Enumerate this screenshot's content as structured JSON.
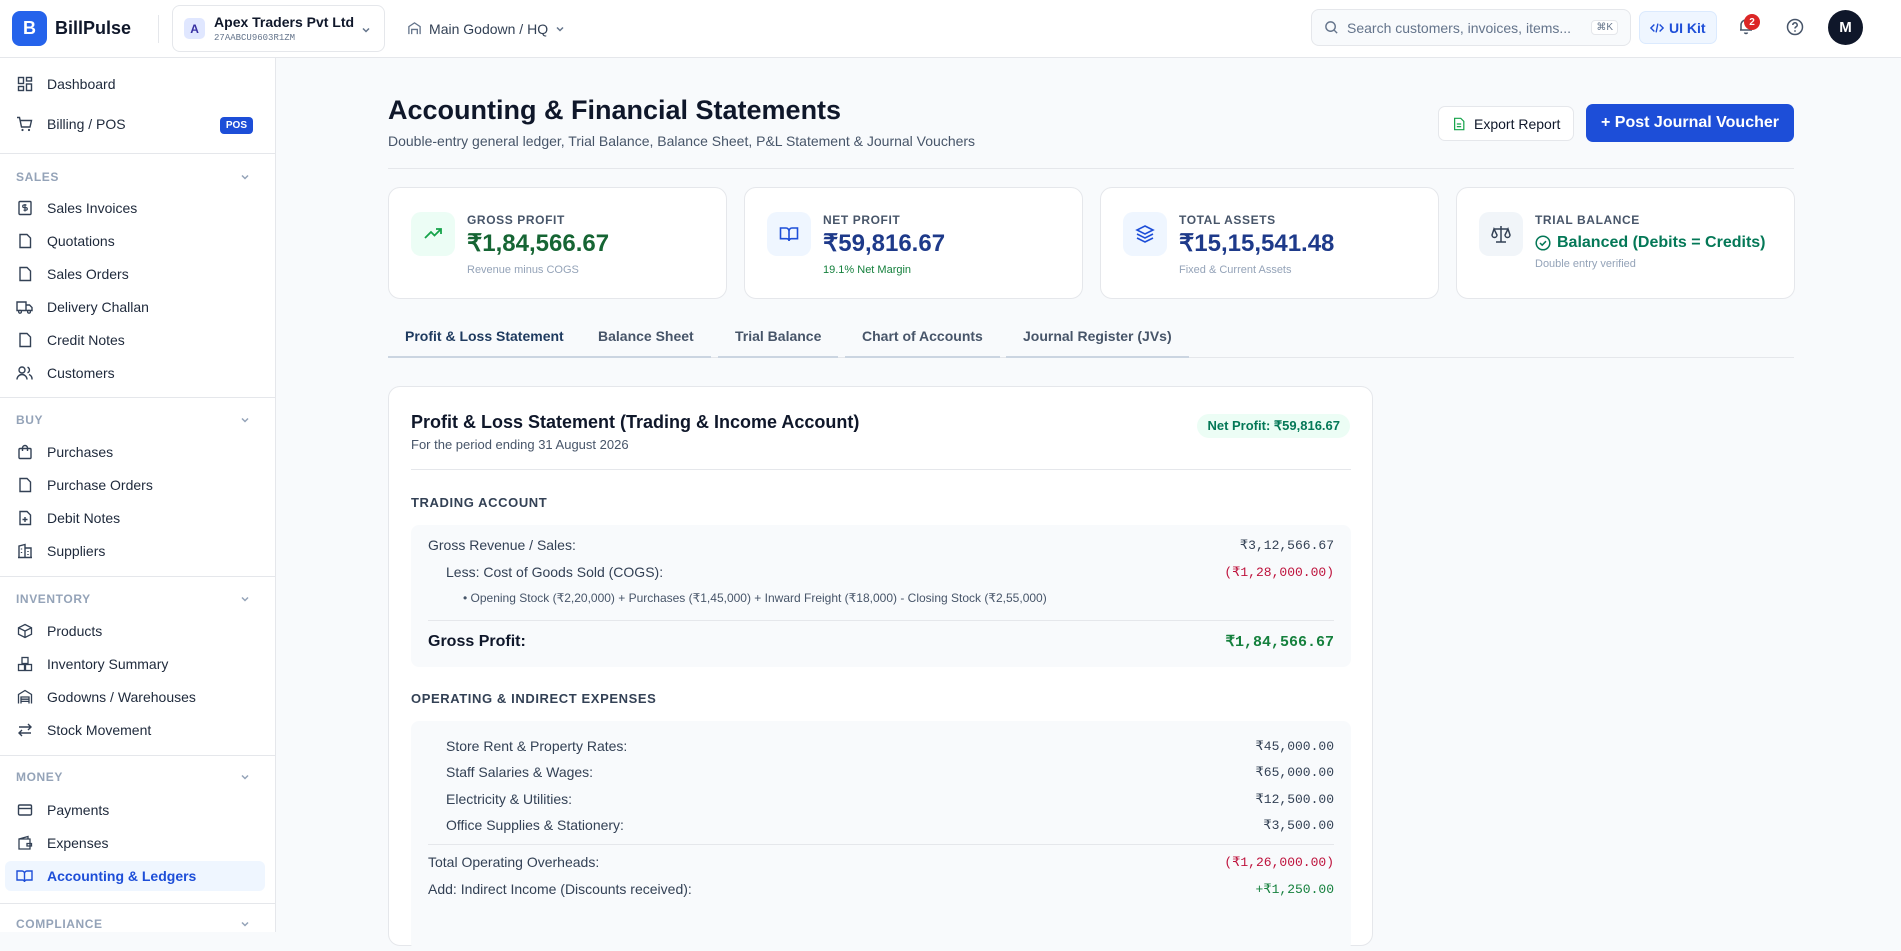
{
  "app": {
    "logo_letter": "B",
    "name": "BillPulse"
  },
  "company": {
    "avatar": "A",
    "name": "Apex Traders Pvt Ltd",
    "gstin": "27AABCU9603R1ZM"
  },
  "location": {
    "label": "Main Godown / HQ"
  },
  "search": {
    "placeholder": "Search customers, invoices, items...",
    "shortcut": "⌘K"
  },
  "header": {
    "ui_kit": "UI Kit",
    "notifications": "2",
    "user_initial": "M"
  },
  "sidebar": {
    "top": [
      {
        "label": "Dashboard",
        "icon": "dashboard-icon"
      },
      {
        "label": "Billing / POS",
        "icon": "cart-icon",
        "badge": "POS"
      }
    ],
    "sections": [
      {
        "title": "SALES",
        "items": [
          "Sales Invoices",
          "Quotations",
          "Sales Orders",
          "Delivery Challan",
          "Credit Notes",
          "Customers"
        ]
      },
      {
        "title": "BUY",
        "items": [
          "Purchases",
          "Purchase Orders",
          "Debit Notes",
          "Suppliers"
        ]
      },
      {
        "title": "INVENTORY",
        "items": [
          "Products",
          "Inventory Summary",
          "Godowns / Warehouses",
          "Stock Movement"
        ]
      },
      {
        "title": "MONEY",
        "items": [
          "Payments",
          "Expenses",
          "Accounting & Ledgers"
        ]
      },
      {
        "title": "COMPLIANCE",
        "items": []
      }
    ]
  },
  "page": {
    "title": "Accounting & Financial Statements",
    "subtitle": "Double-entry general ledger, Trial Balance, Balance Sheet, P&L Statement & Journal Vouchers",
    "export_label": "Export Report",
    "post_label": "+ Post Journal Voucher"
  },
  "kpis": [
    {
      "label": "GROSS PROFIT",
      "value": "₹1,84,566.67",
      "note": "Revenue minus COGS",
      "color": "#166534"
    },
    {
      "label": "NET PROFIT",
      "value": "₹59,816.67",
      "note": "19.1% Net Margin",
      "color": "#1e3a8a"
    },
    {
      "label": "TOTAL ASSETS",
      "value": "₹15,15,541.48",
      "note": "Fixed & Current Assets",
      "color": "#1e3a8a"
    },
    {
      "label": "TRIAL BALANCE",
      "value": "Balanced (Debits = Credits)",
      "note": "Double entry verified",
      "color": "#047857"
    }
  ],
  "tabs": [
    "Profit & Loss Statement",
    "Balance Sheet",
    "Trial Balance",
    "Chart of Accounts",
    "Journal Register (JVs)"
  ],
  "statement": {
    "title": "Profit & Loss Statement (Trading & Income Account)",
    "subtitle": "For the period ending 31 August 2026",
    "net_profit_badge": "Net Profit: ₹59,816.67",
    "trading": {
      "title": "TRADING ACCOUNT",
      "gross_revenue_label": "Gross Revenue / Sales:",
      "gross_revenue_value": "₹3,12,566.67",
      "cogs_label": "Less: Cost of Goods Sold (COGS):",
      "cogs_value": "(₹1,28,000.00)",
      "cogs_note": "• Opening Stock (₹2,20,000) + Purchases (₹1,45,000) + Inward Freight (₹18,000) - Closing Stock (₹2,55,000)",
      "gross_profit_label": "Gross Profit:",
      "gross_profit_value": "₹1,84,566.67"
    },
    "operating": {
      "title": "OPERATING & INDIRECT EXPENSES",
      "rows": [
        {
          "label": "Store Rent & Property Rates:",
          "value": "₹45,000.00"
        },
        {
          "label": "Staff Salaries & Wages:",
          "value": "₹65,000.00"
        },
        {
          "label": "Electricity & Utilities:",
          "value": "₹12,500.00"
        },
        {
          "label": "Office Supplies & Stationery:",
          "value": "₹3,500.00"
        }
      ],
      "total_label": "Total Operating Overheads:",
      "total_value": "(₹1,26,000.00)",
      "indirect_label": "Add: Indirect Income (Discounts received):",
      "indirect_value": "+₹1,250.00"
    }
  }
}
